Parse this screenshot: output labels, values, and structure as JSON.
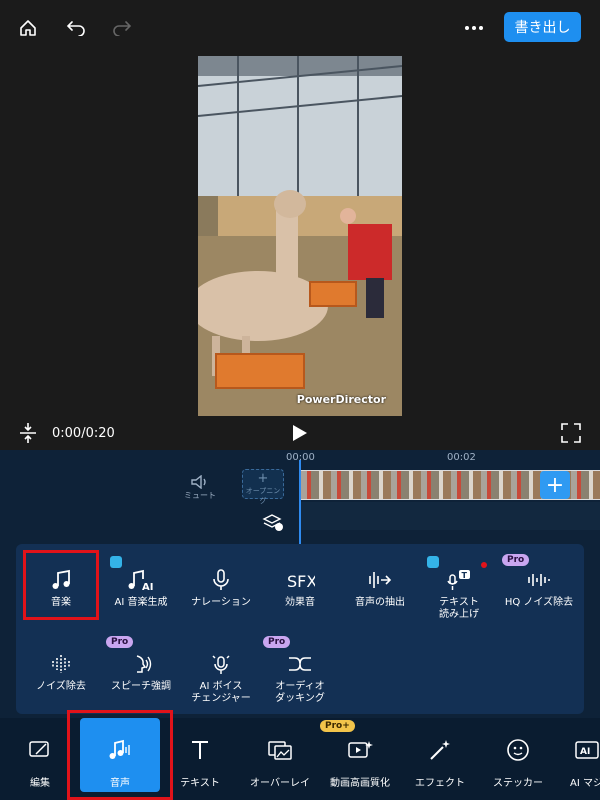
{
  "topbar": {
    "export_label": "書き出し"
  },
  "preview": {
    "watermark": "PowerDirector"
  },
  "playback": {
    "time": "0:00/0:20"
  },
  "timeline": {
    "ruler": [
      "00:00",
      "00:02"
    ],
    "mute_label": "ミュート",
    "opening_label": "オープニング"
  },
  "audio_tools": {
    "row1": [
      {
        "label": "音楽",
        "icon": "music-note-icon"
      },
      {
        "label": "AI 音楽生成",
        "icon": "ai-music-icon"
      },
      {
        "label": "ナレーション",
        "icon": "microphone-icon"
      },
      {
        "label": "効果音",
        "icon": "sfx-icon"
      },
      {
        "label": "音声の抽出",
        "icon": "extract-audio-icon"
      },
      {
        "label": "テキスト\n読み上げ",
        "icon": "text-to-speech-icon"
      },
      {
        "label": "HQ ノイズ除去",
        "icon": "hq-denoise-icon"
      }
    ],
    "row2": [
      {
        "label": "ノイズ除去",
        "icon": "denoise-icon"
      },
      {
        "label": "スピーチ強調",
        "icon": "speech-enhance-icon"
      },
      {
        "label": "AI ボイス\nチェンジャー",
        "icon": "ai-voice-changer-icon"
      },
      {
        "label": "オーディオ\nダッキング",
        "icon": "audio-ducking-icon"
      }
    ],
    "badges": {
      "pro": "Pro"
    }
  },
  "bottomnav": {
    "items": [
      {
        "label": "編集",
        "icon": "edit-icon"
      },
      {
        "label": "音声",
        "icon": "audio-icon"
      },
      {
        "label": "テキスト",
        "icon": "text-icon"
      },
      {
        "label": "オーバーレイ",
        "icon": "overlay-icon"
      },
      {
        "label": "動画高画質化",
        "icon": "video-enhance-icon"
      },
      {
        "label": "エフェクト",
        "icon": "effect-icon"
      },
      {
        "label": "ステッカー",
        "icon": "sticker-icon"
      },
      {
        "label": "AI マジ",
        "icon": "ai-magic-icon"
      }
    ],
    "pro_plus": "Pro+"
  },
  "colors": {
    "accent": "#1e8ff0",
    "highlight": "#e1131a",
    "panel": "#133054",
    "timeline": "#0e2238"
  }
}
